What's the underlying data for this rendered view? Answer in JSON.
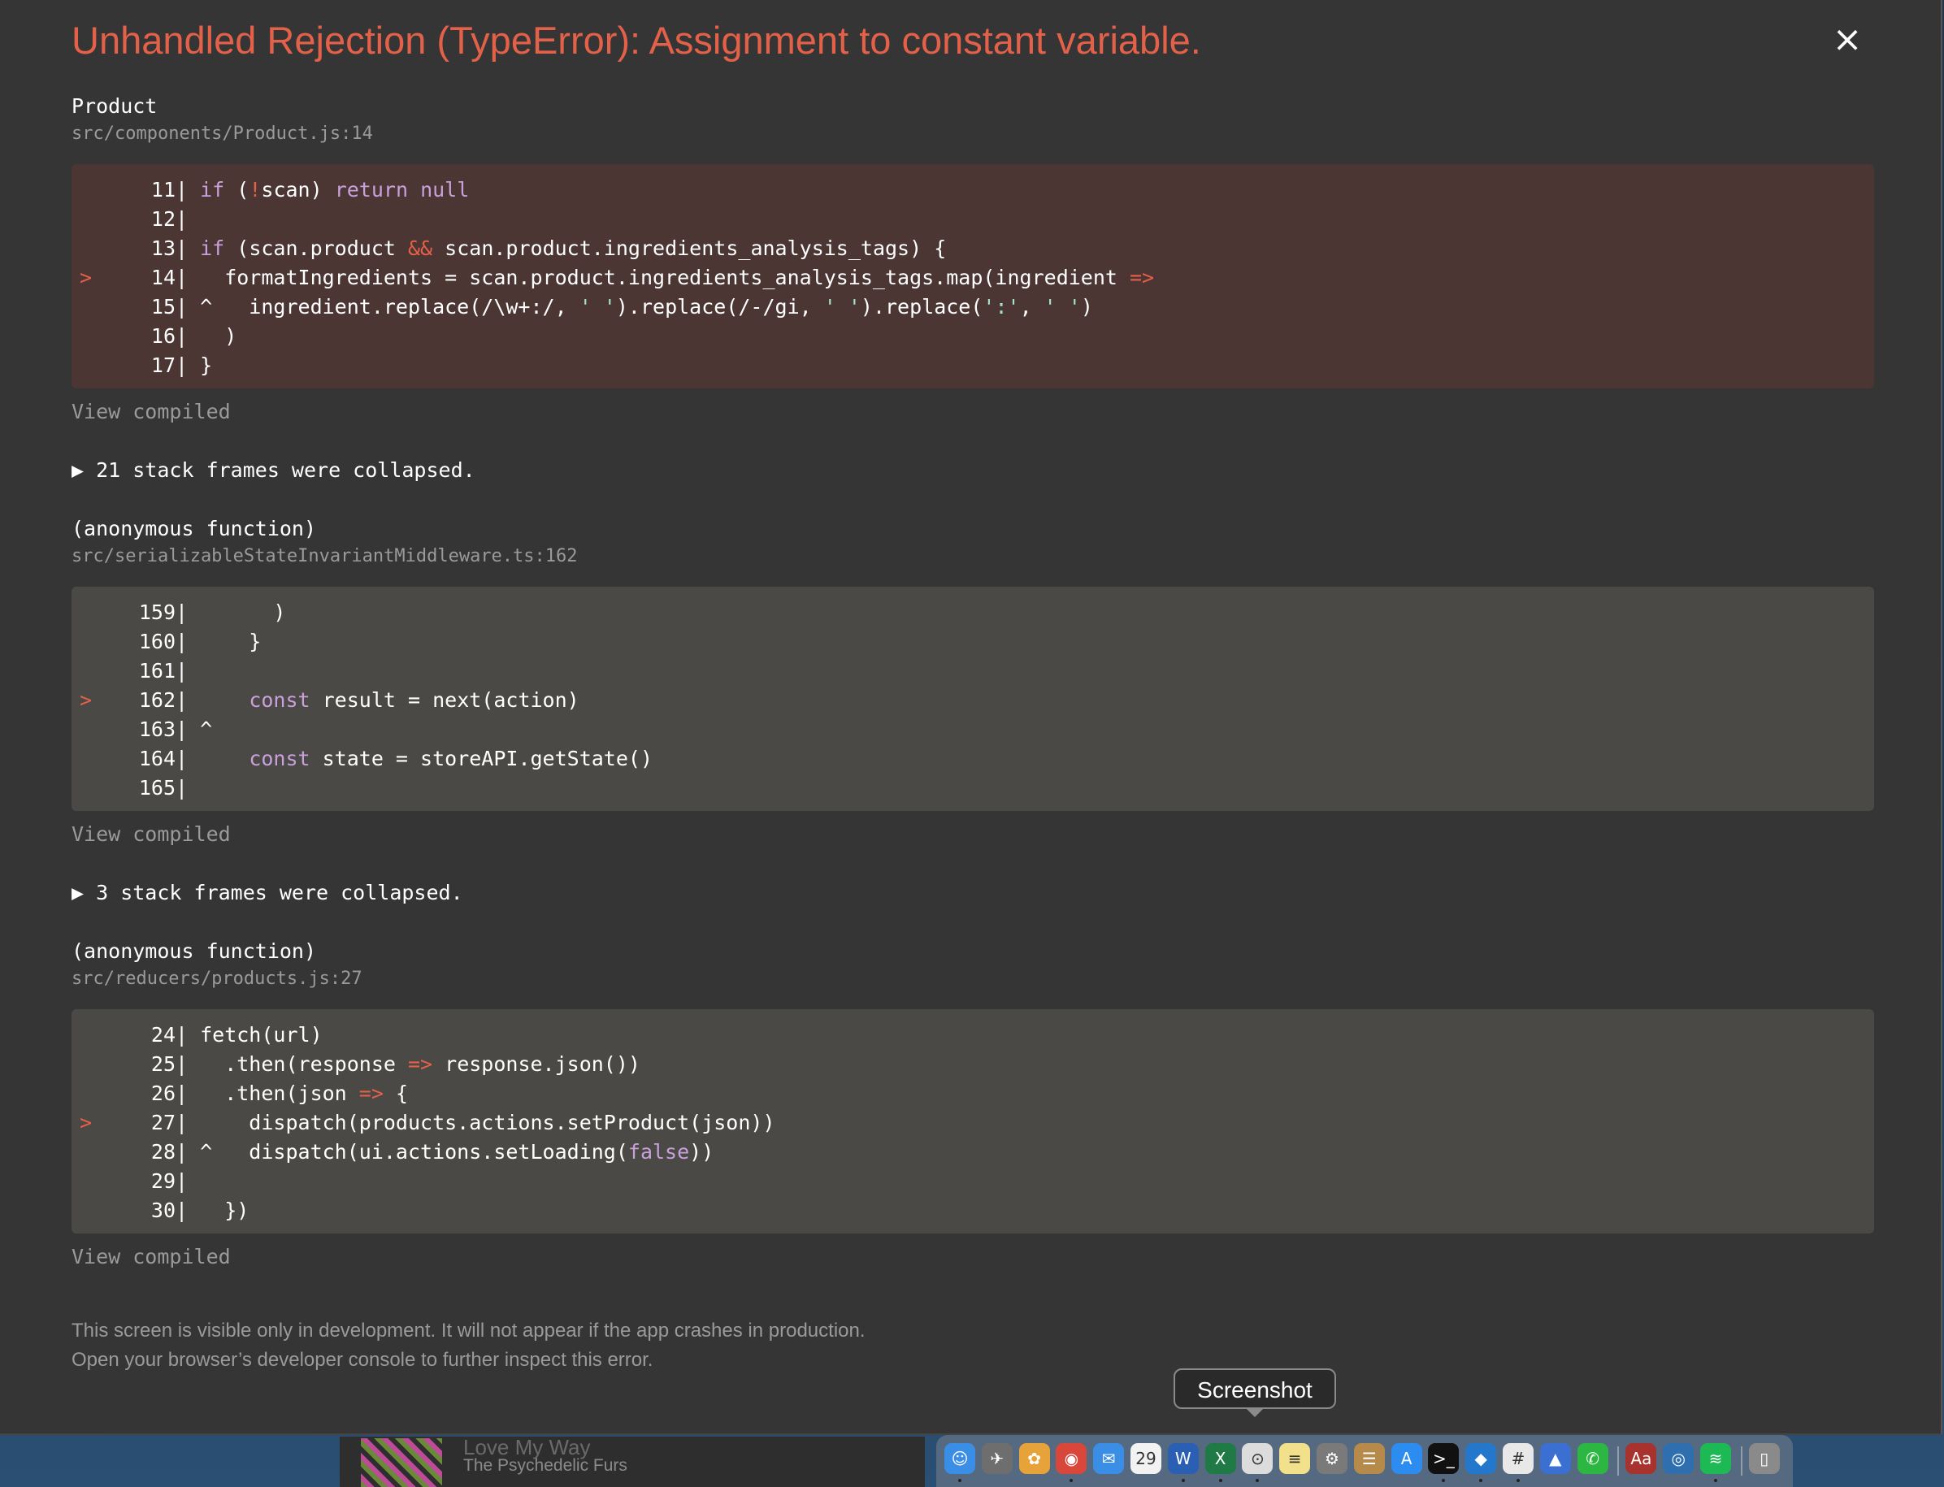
{
  "overlay": {
    "title": "Unhandled Rejection (TypeError): Assignment to constant variable.",
    "close_label": "×",
    "frames": [
      {
        "fn": "Product",
        "file": "src/components/Product.js:14",
        "variant": "error",
        "lines": [
          {
            "marker": "",
            "num": "11",
            "code": "| if (!scan) return null"
          },
          {
            "marker": "",
            "num": "12",
            "code": "|"
          },
          {
            "marker": "",
            "num": "13",
            "code": "| if (scan.product && scan.product.ingredients_analysis_tags) {"
          },
          {
            "marker": ">",
            "num": "14",
            "code": "|   formatIngredients = scan.product.ingredients_analysis_tags.map(ingredient =>"
          },
          {
            "marker": "",
            "num": "15",
            "code": "| ^   ingredient.replace(/\\w+:/, ' ').replace(/-/gi, ' ').replace(':', ' ')"
          },
          {
            "marker": "",
            "num": "16",
            "code": "|   )"
          },
          {
            "marker": "",
            "num": "17",
            "code": "| }"
          }
        ],
        "view_compiled": "View compiled",
        "collapsed": "▶ 21 stack frames were collapsed."
      },
      {
        "fn": "(anonymous function)",
        "file": "src/serializableStateInvariantMiddleware.ts:162",
        "variant": "neutral",
        "lines": [
          {
            "marker": "",
            "num": "159",
            "code": "|       )"
          },
          {
            "marker": "",
            "num": "160",
            "code": "|     }"
          },
          {
            "marker": "",
            "num": "161",
            "code": "|"
          },
          {
            "marker": ">",
            "num": "162",
            "code": "|     const result = next(action)"
          },
          {
            "marker": "",
            "num": "163",
            "code": "| ^"
          },
          {
            "marker": "",
            "num": "164",
            "code": "|     const state = storeAPI.getState()"
          },
          {
            "marker": "",
            "num": "165",
            "code": "|"
          }
        ],
        "view_compiled": "View compiled",
        "collapsed": "▶ 3 stack frames were collapsed."
      },
      {
        "fn": "(anonymous function)",
        "file": "src/reducers/products.js:27",
        "variant": "neutral",
        "lines": [
          {
            "marker": "",
            "num": "24",
            "code": "| fetch(url)"
          },
          {
            "marker": "",
            "num": "25",
            "code": "|   .then(response => response.json())"
          },
          {
            "marker": "",
            "num": "26",
            "code": "|   .then(json => {"
          },
          {
            "marker": ">",
            "num": "27",
            "code": "|     dispatch(products.actions.setProduct(json))"
          },
          {
            "marker": "",
            "num": "28",
            "code": "| ^   dispatch(ui.actions.setLoading(false))"
          },
          {
            "marker": "",
            "num": "29",
            "code": "|"
          },
          {
            "marker": "",
            "num": "30",
            "code": "|   })"
          }
        ],
        "view_compiled": "View compiled",
        "collapsed": ""
      }
    ],
    "footer_line1": "This screen is visible only in development. It will not appear if the app crashes in production.",
    "footer_line2": "Open your browser’s developer console to further inspect this error."
  },
  "tooltip": {
    "label": "Screenshot"
  },
  "now_playing": {
    "title": "Love My Way",
    "artist": "The Psychedelic Furs"
  },
  "dock": {
    "items": [
      {
        "name": "finder-icon",
        "glyph": "☺",
        "color": "#3a8ee6",
        "dot": true
      },
      {
        "name": "launchpad-icon",
        "glyph": "✈",
        "color": "#6e6e6e",
        "dot": false
      },
      {
        "name": "photos-icon",
        "glyph": "✿",
        "color": "#e8a23a",
        "dot": false
      },
      {
        "name": "chrome-icon",
        "glyph": "◉",
        "color": "#d9473a",
        "dot": true
      },
      {
        "name": "messenger-icon",
        "glyph": "✉",
        "color": "#3a8ee6",
        "dot": false
      },
      {
        "name": "calendar-icon",
        "glyph": "29",
        "color": "#f2f2f2",
        "dot": false
      },
      {
        "name": "word-icon",
        "glyph": "W",
        "color": "#2b5fb4",
        "dot": true
      },
      {
        "name": "excel-icon",
        "glyph": "X",
        "color": "#1f7a45",
        "dot": true
      },
      {
        "name": "screenshot-icon",
        "glyph": "⊙",
        "color": "#dcdcdc",
        "dot": true
      },
      {
        "name": "notes-icon",
        "glyph": "≡",
        "color": "#f3e08a",
        "dot": false
      },
      {
        "name": "system-preferences-icon",
        "glyph": "⚙",
        "color": "#7a7a7a",
        "dot": false
      },
      {
        "name": "contacts-icon",
        "glyph": "☰",
        "color": "#b58a4a",
        "dot": false
      },
      {
        "name": "app-store-icon",
        "glyph": "A",
        "color": "#2d8cf0",
        "dot": false
      },
      {
        "name": "terminal-icon",
        "glyph": ">_",
        "color": "#111111",
        "dot": true
      },
      {
        "name": "vscode-icon",
        "glyph": "◆",
        "color": "#2478cc",
        "dot": true
      },
      {
        "name": "slack-icon",
        "glyph": "#",
        "color": "#e8e8e8",
        "dot": true
      },
      {
        "name": "nordvpn-icon",
        "glyph": "▲",
        "color": "#3b6fd1",
        "dot": false
      },
      {
        "name": "whatsapp-icon",
        "glyph": "✆",
        "color": "#2bb741",
        "dot": false
      },
      {
        "name": "dictionary-icon",
        "glyph": "Aa",
        "color": "#a8322e",
        "dot": false
      },
      {
        "name": "safari-icon",
        "glyph": "◎",
        "color": "#2f6fb0",
        "dot": false
      },
      {
        "name": "spotify-icon",
        "glyph": "≋",
        "color": "#1db954",
        "dot": true
      },
      {
        "name": "trash-icon",
        "glyph": "▯",
        "color": "#8a8a8a",
        "dot": false
      }
    ]
  }
}
